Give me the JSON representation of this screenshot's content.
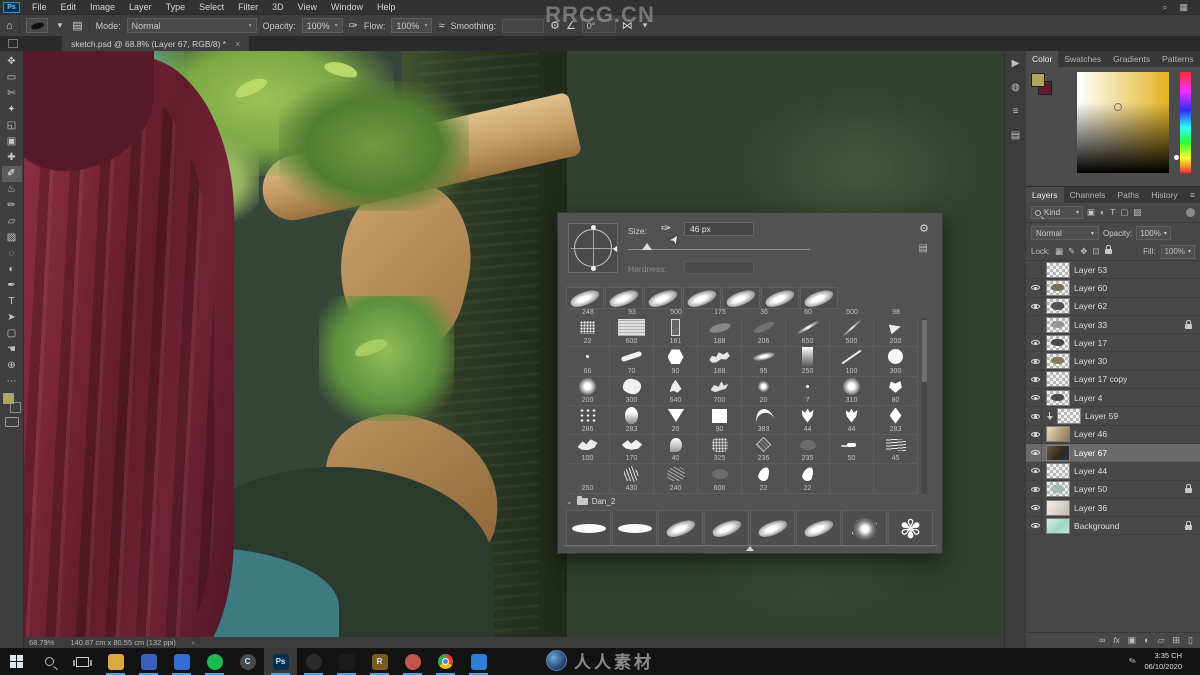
{
  "colors": {
    "accent_blue": "#2d8ceb",
    "foreground_swatch": "#b3a65b",
    "selection_gray": "#6a6a6a",
    "running_indicator": "#5a9fd4"
  },
  "watermarks": {
    "top": "RRCG.CN",
    "bottom_text": "人人素材"
  },
  "menubar": {
    "app_badge": "Ps",
    "items": [
      "File",
      "Edit",
      "Image",
      "Layer",
      "Type",
      "Select",
      "Filter",
      "3D",
      "View",
      "Window",
      "Help"
    ],
    "right_icons": [
      {
        "name": "search-icon",
        "glyph": "⌕"
      },
      {
        "name": "workspace-icon",
        "glyph": "▦"
      }
    ]
  },
  "optionsbar": {
    "home_icon": "⌂",
    "brush_caret": "▾",
    "brush_settings_icon": "▤",
    "mode_label": "Mode:",
    "mode_value": "Normal",
    "opacity_label": "Opacity:",
    "opacity_value": "100%",
    "pressure_icon": "✑",
    "flow_label": "Flow:",
    "flow_value": "100%",
    "airbrush_icon": "≈",
    "smoothing_label": "Smoothing:",
    "smoothing_value": "",
    "gear_icon": "⚙",
    "angle_icon": "∠",
    "angle_value": "0°",
    "symmetry_icon": "⋈",
    "symmetry_caret": "▾"
  },
  "document_tab": {
    "title": "sketch.psd @ 68.8% (Layer 67, RGB/8) *",
    "close": "×"
  },
  "toolbar": {
    "tools": [
      {
        "name": "move-tool",
        "glyph": "✥"
      },
      {
        "name": "marquee-tool",
        "glyph": "▭"
      },
      {
        "name": "lasso-tool",
        "glyph": "✄"
      },
      {
        "name": "quick-selection-tool",
        "glyph": "✦"
      },
      {
        "name": "crop-tool",
        "glyph": "◱"
      },
      {
        "name": "frame-tool",
        "glyph": "▣"
      },
      {
        "name": "healing-brush-tool",
        "glyph": "✚"
      },
      {
        "name": "brush-tool",
        "glyph": "✐",
        "selected": true
      },
      {
        "name": "clone-stamp-tool",
        "glyph": "♨"
      },
      {
        "name": "history-brush-tool",
        "glyph": "✏"
      },
      {
        "name": "eraser-tool",
        "glyph": "▱"
      },
      {
        "name": "gradient-tool",
        "glyph": "▨"
      },
      {
        "name": "blur-tool",
        "glyph": "◌"
      },
      {
        "name": "dodge-tool",
        "glyph": "◐"
      },
      {
        "name": "pen-tool",
        "glyph": "✒"
      },
      {
        "name": "type-tool",
        "glyph": "T"
      },
      {
        "name": "path-selection-tool",
        "glyph": "➤"
      },
      {
        "name": "shape-tool",
        "glyph": "▢"
      },
      {
        "name": "hand-tool",
        "glyph": "☚"
      },
      {
        "name": "zoom-tool",
        "glyph": "⊕"
      },
      {
        "name": "toolbar-ellipsis",
        "glyph": "⋯"
      }
    ],
    "foreground_color": "#b3a65b",
    "background_color": "#5c1f2e"
  },
  "dock": {
    "icons": [
      {
        "name": "actions-panel-icon",
        "glyph": "▶"
      },
      {
        "name": "info-panel-icon",
        "glyph": "◍"
      },
      {
        "name": "properties-panel-icon",
        "glyph": "≡"
      },
      {
        "name": "brush-settings-panel-icon",
        "glyph": "▤"
      }
    ]
  },
  "brush_popup": {
    "size_label": "Size:",
    "size_value": "46 px",
    "size_pressure_icon": "✑",
    "hardness_label": "Hardness:",
    "hardness_value": "",
    "gear_icon": "⚙",
    "panel_icon": "▤",
    "group_caret": "⌄",
    "group_label": "Dan_2",
    "recent": [
      "bigstroke",
      "bigstroke",
      "bigstroke",
      "bigstroke",
      "bigstroke",
      "bigstroke",
      "bigstroke"
    ],
    "grid_top_numbers": [
      "248",
      "93",
      "500",
      "175",
      "36",
      "60",
      "500",
      "98"
    ],
    "grid_rows": [
      [
        {
          "s": "spatterbox",
          "n": "22"
        },
        {
          "s": "texsquare",
          "n": "600"
        },
        {
          "s": "thinrect",
          "n": "161"
        },
        {
          "s": "wisp",
          "n": "188"
        },
        {
          "s": "wisp2",
          "n": "206"
        },
        {
          "s": "streak",
          "n": "650"
        },
        {
          "s": "streak2",
          "n": "500"
        },
        {
          "s": "arrow",
          "n": "200"
        }
      ],
      [
        {
          "s": "tinydot",
          "n": "66"
        },
        {
          "s": "stroke",
          "n": "70"
        },
        {
          "s": "hex",
          "n": "90"
        },
        {
          "s": "spatter",
          "n": "188"
        },
        {
          "s": "softstreak",
          "n": "95"
        },
        {
          "s": "gradbar",
          "n": "250"
        },
        {
          "s": "thinline",
          "n": "100"
        },
        {
          "s": "round",
          "n": "300"
        }
      ],
      [
        {
          "s": "soft",
          "n": "200"
        },
        {
          "s": "splat",
          "n": "300"
        },
        {
          "s": "trileaf",
          "n": "640"
        },
        {
          "s": "lizard",
          "n": "700"
        },
        {
          "s": "softdot",
          "n": "20"
        },
        {
          "s": "tinydot",
          "n": "7"
        },
        {
          "s": "soft",
          "n": "310"
        },
        {
          "s": "leafheart",
          "n": "80"
        }
      ],
      [
        {
          "s": "dots",
          "n": "286"
        },
        {
          "s": "egg",
          "n": "283"
        },
        {
          "s": "tri",
          "n": "20"
        },
        {
          "s": "square",
          "n": "90"
        },
        {
          "s": "curve",
          "n": "383"
        },
        {
          "s": "tulip",
          "n": "44"
        },
        {
          "s": "tulip",
          "n": "44"
        },
        {
          "s": "diamond",
          "n": "283"
        }
      ],
      [
        {
          "s": "wing",
          "n": "100"
        },
        {
          "s": "wing2",
          "n": "170"
        },
        {
          "s": "shell",
          "n": "40"
        },
        {
          "s": "noise",
          "n": "325"
        },
        {
          "s": "net",
          "n": "236"
        },
        {
          "s": "faint",
          "n": "235"
        },
        {
          "s": "dotdash",
          "n": "50"
        },
        {
          "s": "scratch",
          "n": "45"
        }
      ],
      [
        {
          "s": "blank",
          "n": "250"
        },
        {
          "s": "fern",
          "n": "430"
        },
        {
          "s": "scribble",
          "n": "240"
        },
        {
          "s": "faint",
          "n": "606"
        },
        {
          "s": "petal",
          "n": "22"
        },
        {
          "s": "petal",
          "n": "22"
        },
        {
          "s": "blank",
          "n": ""
        },
        {
          "s": "blank",
          "n": ""
        }
      ]
    ],
    "large": [
      {
        "type": "flat"
      },
      {
        "type": "flat"
      },
      {
        "type": "bigstroke"
      },
      {
        "type": "bigstroke"
      },
      {
        "type": "bigstroke"
      },
      {
        "type": "bigstroke"
      },
      {
        "type": "spatterbig"
      },
      {
        "type": "leafglyph",
        "glyph": "✾"
      }
    ]
  },
  "panels": {
    "color": {
      "tabs": [
        "Color",
        "Swatches",
        "Gradients",
        "Patterns"
      ],
      "menu_icon": "≡"
    },
    "layers": {
      "tabs": [
        "Layers",
        "Channels",
        "Paths",
        "History"
      ],
      "menu_icon": "≡",
      "kind_label": "Kind",
      "kind_caret": "▾",
      "filter_icons": [
        {
          "name": "filter-pixel-layers-icon",
          "glyph": "▣"
        },
        {
          "name": "filter-adjustment-layers-icon",
          "glyph": "◐"
        },
        {
          "name": "filter-type-layers-icon",
          "glyph": "T"
        },
        {
          "name": "filter-shape-layers-icon",
          "glyph": "▢"
        },
        {
          "name": "filter-smart-objects-icon",
          "glyph": "▨"
        }
      ],
      "blend_mode": "Normal",
      "blend_caret": "▾",
      "opacity_label": "Opacity:",
      "opacity_value": "100%",
      "lock_label": "Lock:",
      "lock_icons": [
        {
          "name": "lock-transparency-icon",
          "glyph": "▦"
        },
        {
          "name": "lock-pixels-icon",
          "glyph": "✎"
        },
        {
          "name": "lock-position-icon",
          "glyph": "✥"
        },
        {
          "name": "lock-artboard-icon",
          "glyph": "⊡"
        },
        {
          "name": "lock-all-icon",
          "css": "lock"
        }
      ],
      "fill_label": "Fill:",
      "fill_value": "100%",
      "layers": [
        {
          "name": "Layer 53",
          "eye": false,
          "thumb": "checker"
        },
        {
          "name": "Layer 60",
          "eye": true,
          "thumb": "checker",
          "smudge": "#6b5a3f"
        },
        {
          "name": "Layer 62",
          "eye": true,
          "thumb": "checker",
          "smudge": "#3a3a3a"
        },
        {
          "name": "Layer 33",
          "eye": false,
          "thumb": "checker",
          "smudge": "#8a8a8a",
          "locked": true
        },
        {
          "name": "Layer 17",
          "eye": true,
          "thumb": "checker",
          "smudge": "#2e2e2e"
        },
        {
          "name": "Layer 30",
          "eye": true,
          "thumb": "checker",
          "smudge": "#7a6a4a"
        },
        {
          "name": "Layer 17 copy",
          "eye": true,
          "thumb": "checker"
        },
        {
          "name": "Layer 4",
          "eye": true,
          "thumb": "checker",
          "smudge": "#333333"
        },
        {
          "name": "Layer 59",
          "eye": true,
          "thumb": "checker",
          "clipped": true
        },
        {
          "name": "Layer 46",
          "eye": true,
          "thumb": "paint-tan"
        },
        {
          "name": "Layer 67",
          "eye": true,
          "thumb": "paint-dark",
          "selected": true
        },
        {
          "name": "Layer 44",
          "eye": true,
          "thumb": "checker"
        },
        {
          "name": "Layer 50",
          "eye": true,
          "thumb": "checker",
          "smudge": "#99b7a9",
          "locked": true
        },
        {
          "name": "Layer 36",
          "eye": true,
          "thumb": "paint-light"
        },
        {
          "name": "Background",
          "eye": true,
          "thumb": "teal",
          "locked": true
        }
      ],
      "footer_icons": [
        {
          "name": "link-layers-icon",
          "glyph": "∞"
        },
        {
          "name": "layer-effects-icon",
          "glyph": "fx"
        },
        {
          "name": "layer-mask-icon",
          "glyph": "▣"
        },
        {
          "name": "adjustment-layer-icon",
          "glyph": "◐"
        },
        {
          "name": "layer-group-icon",
          "glyph": "▱"
        },
        {
          "name": "new-layer-icon",
          "glyph": "⊞"
        },
        {
          "name": "delete-layer-icon",
          "glyph": "▯"
        }
      ]
    }
  },
  "statusbar": {
    "zoom": "68.79%",
    "doc_info": "140.87 cm x 80.55 cm (132 ppi)",
    "chevron": "›"
  },
  "taskbar": {
    "time": "3:35 CH",
    "date": "06/10/2020",
    "tray_icon": "✎",
    "items": [
      {
        "name": "start-button",
        "kind": "win"
      },
      {
        "name": "search-button",
        "kind": "mag"
      },
      {
        "name": "task-view-button",
        "kind": "taskview"
      },
      {
        "name": "file-explorer",
        "kind": "app",
        "color": "#dba940",
        "running": true
      },
      {
        "name": "app-blue-check",
        "kind": "app",
        "color": "#3b5fc0",
        "running": true
      },
      {
        "name": "app-blue-book",
        "kind": "app",
        "color": "#2f6fd0",
        "running": true
      },
      {
        "name": "spotify",
        "kind": "app",
        "color": "#1db954",
        "shape": "circle",
        "running": true
      },
      {
        "name": "app-circle-c",
        "kind": "app",
        "color": "#4a4a4a",
        "shape": "circle",
        "label": "C"
      },
      {
        "name": "photoshop",
        "kind": "app",
        "color": "#06314e",
        "label": "Ps",
        "active": true,
        "running": true
      },
      {
        "name": "obs",
        "kind": "app",
        "color": "#2b2b2b",
        "shape": "circle",
        "running": true
      },
      {
        "name": "app-dark",
        "kind": "app",
        "color": "#1c1c1c",
        "running": true
      },
      {
        "name": "app-gold",
        "kind": "app",
        "color": "#7d5a1e",
        "label": "R",
        "running": true
      },
      {
        "name": "app-palette",
        "kind": "app",
        "color": "#c0564a",
        "shape": "circle",
        "running": true
      },
      {
        "name": "chrome",
        "kind": "chrome",
        "running": true
      },
      {
        "name": "photos",
        "kind": "app",
        "color": "#2f7fd6",
        "running": true
      }
    ]
  }
}
